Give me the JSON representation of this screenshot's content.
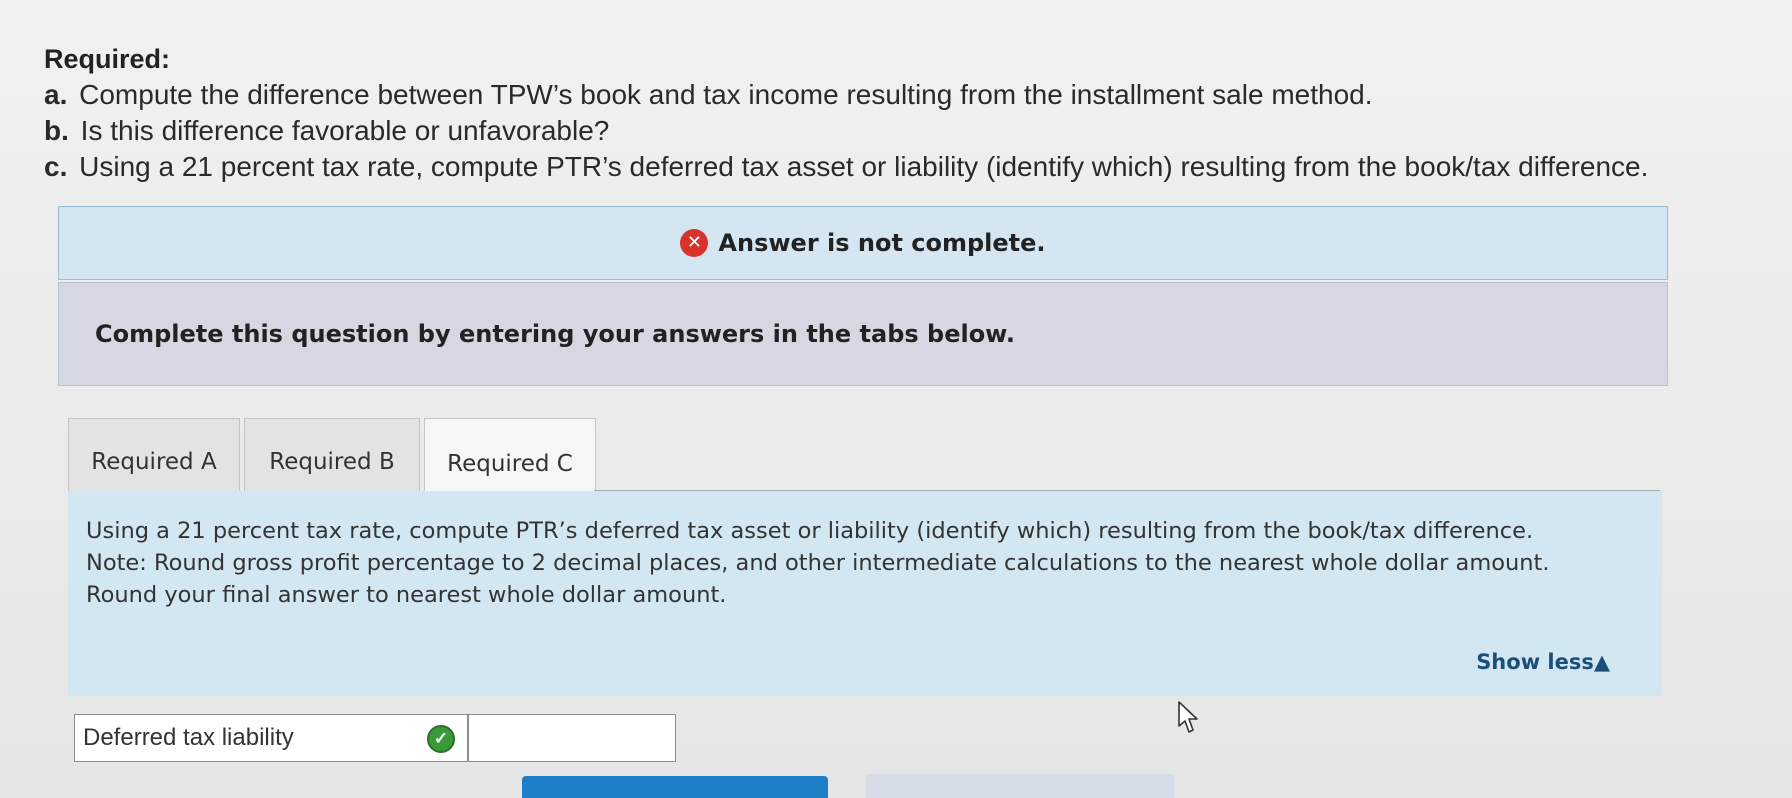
{
  "required": {
    "title": "Required:",
    "items": [
      {
        "tag": "a.",
        "text": "Compute the difference between TPW’s book and tax income resulting from the installment sale method."
      },
      {
        "tag": "b.",
        "text": "Is this difference favorable or unfavorable?"
      },
      {
        "tag": "c.",
        "text": "Using a 21 percent tax rate, compute PTR’s deferred tax asset or liability (identify which) resulting from the book/tax difference."
      }
    ]
  },
  "status": {
    "icon": "x-circle-icon",
    "color": "#d9322b",
    "message": "Answer is not complete."
  },
  "instruction": "Complete this question by entering your answers in the tabs below.",
  "tabs": [
    {
      "label": "Required A",
      "active": false
    },
    {
      "label": "Required B",
      "active": false
    },
    {
      "label": "Required C",
      "active": true
    }
  ],
  "panel": {
    "question": "Using a 21 percent tax rate, compute PTR’s deferred tax asset or liability (identify which) resulting from the book/tax difference.",
    "note": "Note: Round gross profit percentage to 2 decimal places, and other intermediate calculations to the nearest whole dollar amount. Round your final answer to nearest whole dollar amount.",
    "show_less": "Show less▲"
  },
  "answer": {
    "selected_value": "Deferred tax liability",
    "check_icon": "check-circle-icon",
    "check_color": "#3a9a3a",
    "amount_value": ""
  }
}
